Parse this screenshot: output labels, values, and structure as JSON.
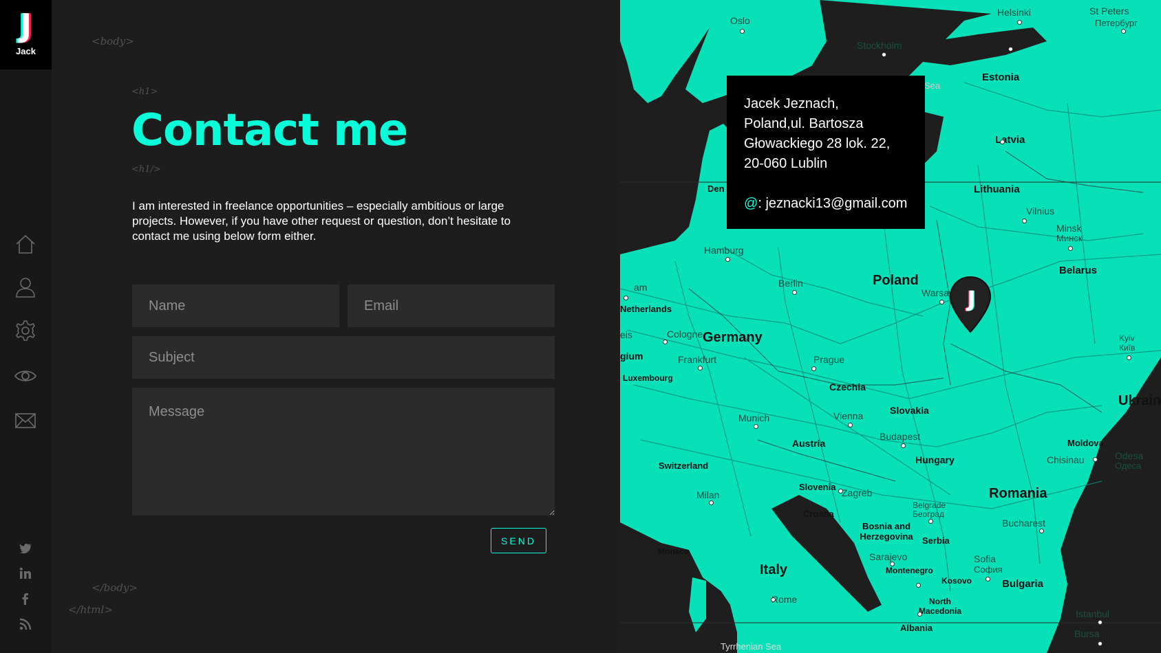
{
  "brand": {
    "logo_letter": "J",
    "name": "Jack"
  },
  "nav": [
    {
      "id": "home",
      "icon": "home-icon"
    },
    {
      "id": "about",
      "icon": "user-icon"
    },
    {
      "id": "skills",
      "icon": "gear-icon"
    },
    {
      "id": "work",
      "icon": "eye-icon"
    },
    {
      "id": "contact",
      "icon": "envelope-icon"
    }
  ],
  "social": [
    "twitter-icon",
    "linkedin-icon",
    "facebook-icon",
    "rss-icon"
  ],
  "tags": {
    "body_open": "<body>",
    "h1_open": "<h1>",
    "h1_close": "<h1/>",
    "body_close": "</body>",
    "html_close": "</html>"
  },
  "heading": "Contact me",
  "intro": "I am interested in freelance opportunities – especially ambitious or large projects. However, if you have other request or question, don’t hesitate to contact me using below form either.",
  "form": {
    "name_placeholder": "Name",
    "email_placeholder": "Email",
    "subject_placeholder": "Subject",
    "message_placeholder": "Message",
    "send_label": "SEND"
  },
  "info": {
    "line1": "Jacek Jeznach,",
    "line2": "Poland,ul. Bartosza",
    "line3": "Głowackiego 28 lok. 22,",
    "line4": "20-060 Lublin",
    "email_prefix": "@",
    "email_sep": ": ",
    "email": "jeznacki13@gmail.com"
  },
  "map": {
    "accent": "#08fdd8",
    "countries": [
      "Estonia",
      "Latvia",
      "Lithuania",
      "Poland",
      "Belarus",
      "Germany",
      "Netherlands",
      "Czechia",
      "Slovakia",
      "Austria",
      "Hungary",
      "Switzerland",
      "Slovenia",
      "Croatia",
      "Bosnia and Herzegovina",
      "Serbia",
      "Montenegro",
      "Kosovo",
      "North Macedonia",
      "Albania",
      "Romania",
      "Moldova",
      "Bulgaria",
      "Italy",
      "Luxembourg",
      "Monaco",
      "Ukraine"
    ],
    "cities": [
      "Oslo",
      "Stockholm",
      "Helsinki",
      "St Peters",
      "Петербург",
      "Hamburg",
      "Berlin",
      "Warsaw",
      "Vilnius",
      "Minsk",
      "Минск",
      "Cologne",
      "Frankfurt",
      "Prague",
      "Munich",
      "Vienna",
      "Budapest",
      "Zagreb",
      "Belgrade",
      "Београд",
      "Milan",
      "Bucharest",
      "Chisinau",
      "Odesa",
      "Одеса",
      "Kyiv",
      "Київ",
      "Sarajevo",
      "Sofia",
      "София",
      "Rome",
      "Den",
      "Sea",
      "Tyrrhenian Sea",
      "Istanbul",
      "Bursa",
      "am",
      "eis",
      "gium"
    ]
  }
}
